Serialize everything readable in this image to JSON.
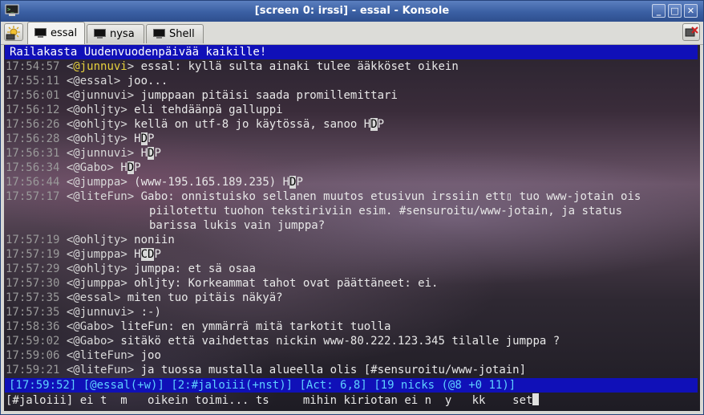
{
  "window": {
    "title": "[screen 0: irssi] - essal - Konsole",
    "buttons": {
      "minimize": "_",
      "maximize": "□",
      "close": "✕"
    }
  },
  "tabs": [
    {
      "label": "essal",
      "active": true
    },
    {
      "label": "nysa",
      "active": false
    },
    {
      "label": "Shell",
      "active": false
    }
  ],
  "topic": "Railakasta Uudenvuodenpäivää kaikille!",
  "messages": [
    {
      "time": "17:54:57",
      "nick": "@junnuvi",
      "text": "essal: kyllä sulta ainaki tulee ääkköset oikein",
      "highlight": true
    },
    {
      "time": "17:55:11",
      "nick": "@essal",
      "text": "joo..."
    },
    {
      "time": "17:56:01",
      "nick": "@junnuvi",
      "text": "jumppaan pitäisi saada promillemittari"
    },
    {
      "time": "17:56:12",
      "nick": "@ohljty",
      "text": "eli tehdäänpä galluppi"
    },
    {
      "time": "17:56:26",
      "nick": "@ohljty",
      "text_a": "kellä on utf-8 jo käytössä, sanoo H",
      "rev": "D",
      "text_b": "P"
    },
    {
      "time": "17:56:28",
      "nick": "@ohljty",
      "text_a": "H",
      "rev": "D",
      "text_b": "P"
    },
    {
      "time": "17:56:31",
      "nick": "@junnuvi",
      "text_a": "H",
      "rev": "D",
      "text_b": "P"
    },
    {
      "time": "17:56:34",
      "nick": "@Gabo",
      "text_a": "H",
      "rev": "D",
      "text_b": "P"
    },
    {
      "time": "17:56:44",
      "nick": "@jumppa",
      "text_a": "(www-195.165.189.235) H",
      "rev": "D",
      "text_b": "P"
    },
    {
      "time": "17:57:17",
      "nick": "@liteFun",
      "text": "Gabo: onnistuisko sellanen muutos etusivun irssiin ett▯ tuo www-jotain ois",
      "cont": [
        "piilotettu tuohon tekstiriviin esim. #sensuroitu/www-jotain, ja status",
        "barissa lukis vain jumppa?"
      ]
    },
    {
      "time": "17:57:19",
      "nick": "@ohljty",
      "text": "noniin"
    },
    {
      "time": "17:57:19",
      "nick": "@jumppa",
      "text_a": "H",
      "rev": "CD",
      "text_b": "P"
    },
    {
      "time": "17:57:29",
      "nick": "@ohljty",
      "text": "jumppa: et sä osaa"
    },
    {
      "time": "17:57:30",
      "nick": "@jumppa",
      "text": "ohljty: Korkeammat tahot ovat päättäneet: ei."
    },
    {
      "time": "17:57:35",
      "nick": "@essal",
      "text": "miten tuo pitäis näkyä?"
    },
    {
      "time": "17:57:35",
      "nick": "@junnuvi",
      "text": ":-)"
    },
    {
      "time": "17:58:36",
      "nick": "@Gabo",
      "text": "liteFun: en ymmärrä mitä tarkotit tuolla"
    },
    {
      "time": "17:59:02",
      "nick": "@Gabo",
      "text": "sitäkö että vaihdettas nickin www-80.222.123.345 tilalle jumppa ?"
    },
    {
      "time": "17:59:06",
      "nick": "@liteFun",
      "text": "joo"
    },
    {
      "time": "17:59:21",
      "nick": "@liteFun",
      "text": "ja tuossa mustalla alueella olis [#sensuroitu/www-jotain]"
    }
  ],
  "status": {
    "time": "[17:59:52]",
    "user": "[@essal(+w)]",
    "window": "[2:#jaloiii(+nst)]",
    "activity": "[Act: 6,8]",
    "nicks": "[19 nicks (@8 +0 11)]"
  },
  "input": {
    "prompt": "[#jaloiii]",
    "text": "ei t  m   oikein toimi... ts     mihin kiriotan ei n  y   kk    set"
  },
  "colors": {
    "titlebar": "#3a5fa3",
    "statusbar": "#1010b8",
    "highlight_nick": "#e6d23c"
  }
}
